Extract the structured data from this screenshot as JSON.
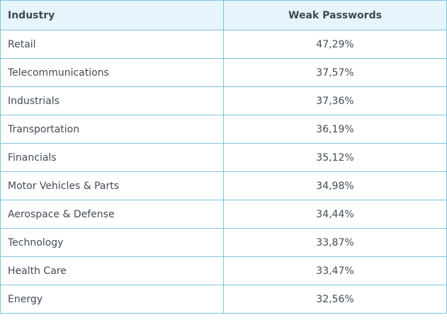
{
  "table": {
    "headers": [
      "Industry",
      "Weak Passwords"
    ],
    "rows": [
      [
        "Retail",
        "47,29%"
      ],
      [
        "Telecommunications",
        "37,57%"
      ],
      [
        "Industrials",
        "37,36%"
      ],
      [
        "Transportation",
        "36,19%"
      ],
      [
        "Financials",
        "35,12%"
      ],
      [
        "Motor Vehicles & Parts",
        "34,98%"
      ],
      [
        "Aerospace & Defense",
        "34,44%"
      ],
      [
        "Technology",
        "33,87%"
      ],
      [
        "Health Care",
        "33,47%"
      ],
      [
        "Energy",
        "32,56%"
      ]
    ]
  },
  "chart_data": {
    "type": "table",
    "columns": [
      "Industry",
      "Weak Passwords"
    ],
    "categories": [
      "Retail",
      "Telecommunications",
      "Industrials",
      "Transportation",
      "Financials",
      "Motor Vehicles & Parts",
      "Aerospace & Defense",
      "Technology",
      "Health Care",
      "Energy"
    ],
    "values": [
      47.29,
      37.57,
      37.36,
      36.19,
      35.12,
      34.98,
      34.44,
      33.87,
      33.47,
      32.56
    ],
    "value_labels": [
      "47,29%",
      "37,57%",
      "37,36%",
      "36,19%",
      "35,12%",
      "34,98%",
      "34,44%",
      "33,87%",
      "33,47%",
      "32,56%"
    ]
  },
  "colors": {
    "border": "#7cc3dd",
    "header_bg": "#e6f5fb",
    "header_text": "#3d4a55",
    "body_text": "#434c56"
  }
}
